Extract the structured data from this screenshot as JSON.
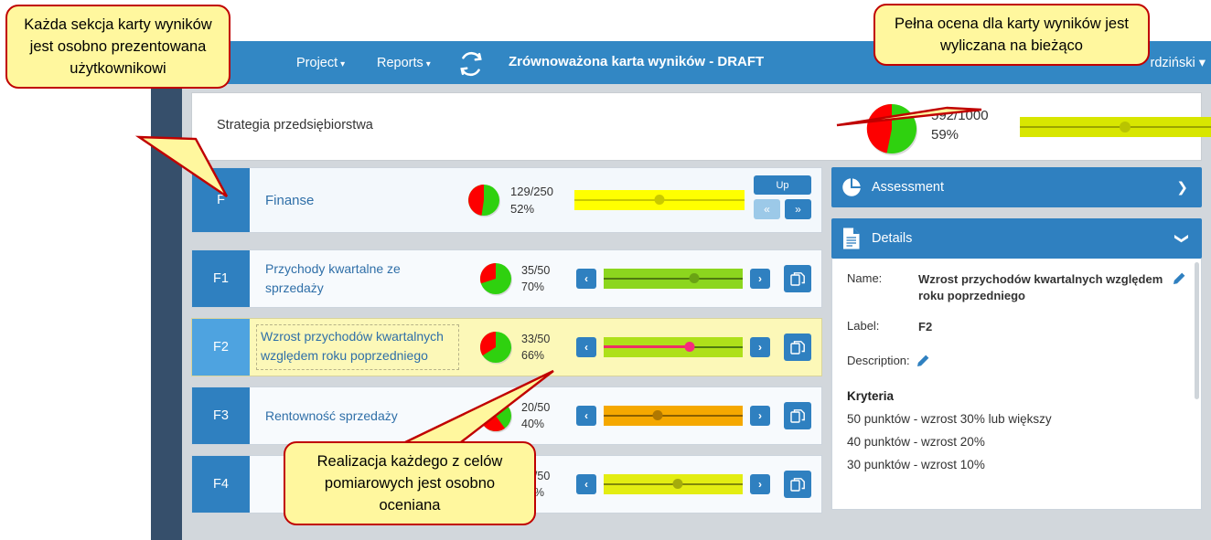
{
  "navbar": {
    "brand_caret": "❯",
    "project_label": "Project",
    "reports_label": "Reports",
    "refresh_icon": "refresh-icon",
    "title": "Zrównoważona karta wyników - DRAFT",
    "user_label": "rdziński ▾",
    "bg_color": "#3287c4"
  },
  "strategy": {
    "name": "Strategia przedsiębiorstwa",
    "score": "592/1000",
    "percent": "59%",
    "pie_green_pct": 59,
    "bar_color": "#d8e600",
    "knob_pct": 47
  },
  "perspective": {
    "tag": "F",
    "name": "Finanse",
    "score": "129/250",
    "percent": "52%",
    "pie_green_pct": 52,
    "bar_color": "#ffff00",
    "knob_pct": 50,
    "up_label": "Up",
    "prev_label": "«",
    "next_label": "»"
  },
  "objectives": [
    {
      "tag": "F1",
      "name": "Przychody kwartalne ze sprzedaży",
      "score": "35/50",
      "percent": "70%",
      "pie_green_pct": 70,
      "bar_color": "#8cd61e",
      "knob_pct": 65,
      "knob_color": "#6aa314",
      "line_color": "#4f7a10",
      "highlighted": false,
      "prev_icon": "chevron-left-icon",
      "next_icon": "chevron-right-icon",
      "copy_icon": "copy-icon"
    },
    {
      "tag": "F2",
      "name": "Wzrost przychodów kwartalnych względem roku poprzedniego",
      "score": "33/50",
      "percent": "66%",
      "pie_green_pct": 66,
      "bar_color": "#aee01a",
      "knob_pct": 62,
      "knob_color": "#f72a7d",
      "line_color": "#4f7a10",
      "highlighted": true,
      "pink_line_pct": 62,
      "prev_icon": "chevron-left-icon",
      "next_icon": "chevron-right-icon",
      "copy_icon": "copy-icon"
    },
    {
      "tag": "F3",
      "name": "Rentowność sprzedaży",
      "score": "20/50",
      "percent": "40%",
      "pie_green_pct": 40,
      "bar_color": "#f5a800",
      "knob_pct": 39,
      "knob_color": "#b07800",
      "line_color": "#8a5f00",
      "highlighted": false,
      "prev_icon": "chevron-left-icon",
      "next_icon": "chevron-right-icon",
      "copy_icon": "copy-icon"
    },
    {
      "tag": "F4",
      "name": "",
      "score": "29/50",
      "percent": "58%",
      "pie_green_pct": 58,
      "bar_color": "#e3ed12",
      "knob_pct": 53,
      "knob_color": "#a5ac0c",
      "line_color": "#82890a",
      "highlighted": false,
      "prev_icon": "chevron-left-icon",
      "next_icon": "chevron-right-icon",
      "copy_icon": "copy-icon"
    }
  ],
  "right_panel": {
    "assessment": {
      "title": "Assessment",
      "icon": "pie-chart-icon",
      "chevron": "❯",
      "expanded": false
    },
    "details": {
      "title": "Details",
      "icon": "document-icon",
      "chevron": "❯",
      "expanded": true,
      "name_label": "Name:",
      "name_value": "Wzrost przychodów kwartalnych względem roku poprzedniego",
      "label_label": "Label:",
      "label_value": "F2",
      "description_label": "Description:",
      "criteria_heading": "Kryteria",
      "criteria": [
        "50 punktów - wzrost 30% lub większy",
        "40 punktów - wzrost 20%",
        "30 punktów - wzrost 10%"
      ]
    }
  },
  "callouts": [
    {
      "text": "Każda sekcja karty wyników jest osobno prezentowana użytkownikowi"
    },
    {
      "text": "Pełna ocena dla karty wyników jest wyliczana na bieżąco"
    },
    {
      "text": "Realizacja każdego z celów pomiarowych jest osobno oceniana"
    }
  ],
  "colors": {
    "accent": "#2f80c0",
    "navbar": "#3287c4",
    "rail": "#364f6b",
    "highlight": "#fcf8b8",
    "callout_bg": "#fff79e",
    "callout_border": "#c00000"
  }
}
